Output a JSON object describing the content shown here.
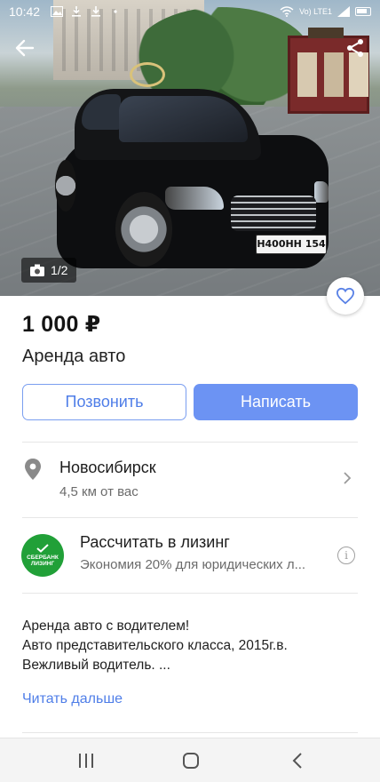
{
  "status_bar": {
    "time": "10:42",
    "network": "Vo) LTE1",
    "icons": [
      "image-icon",
      "download-icon",
      "download-icon",
      "more-dots-icon",
      "wifi-icon",
      "signal-icon",
      "battery-icon"
    ]
  },
  "hero": {
    "plate_text": "Н400НН 154",
    "photo_counter": "1/2",
    "camera_icon": "camera-icon"
  },
  "header": {
    "back_icon": "arrow-left-icon",
    "share_icon": "share-icon",
    "favorite_icon": "heart-icon"
  },
  "listing": {
    "price": "1 000 ₽",
    "title": "Аренда авто"
  },
  "actions": {
    "call_label": "Позвонить",
    "write_label": "Написать"
  },
  "location": {
    "city": "Новосибирск",
    "distance": "4,5 км от вас",
    "pin_icon": "location-pin-icon",
    "chevron_icon": "chevron-right-icon"
  },
  "leasing": {
    "logo_line1": "СБЕРБАНК",
    "logo_line2": "ЛИЗИНГ",
    "title": "Рассчитать в лизинг",
    "subtitle": "Экономия 20% для юридических л...",
    "info_icon": "info-icon"
  },
  "description": {
    "line1": "Аренда авто с водителем!",
    "line2": "Авто представительского класса, 2015г.в.",
    "line3": "Вежливый водитель. ...",
    "read_more": "Читать дальше"
  },
  "navbar": {
    "icons": [
      "recents-icon",
      "home-icon",
      "back-icon"
    ]
  },
  "colors": {
    "accent": "#6c93f3",
    "link": "#4f7ee8",
    "sber_green": "#21a038"
  }
}
